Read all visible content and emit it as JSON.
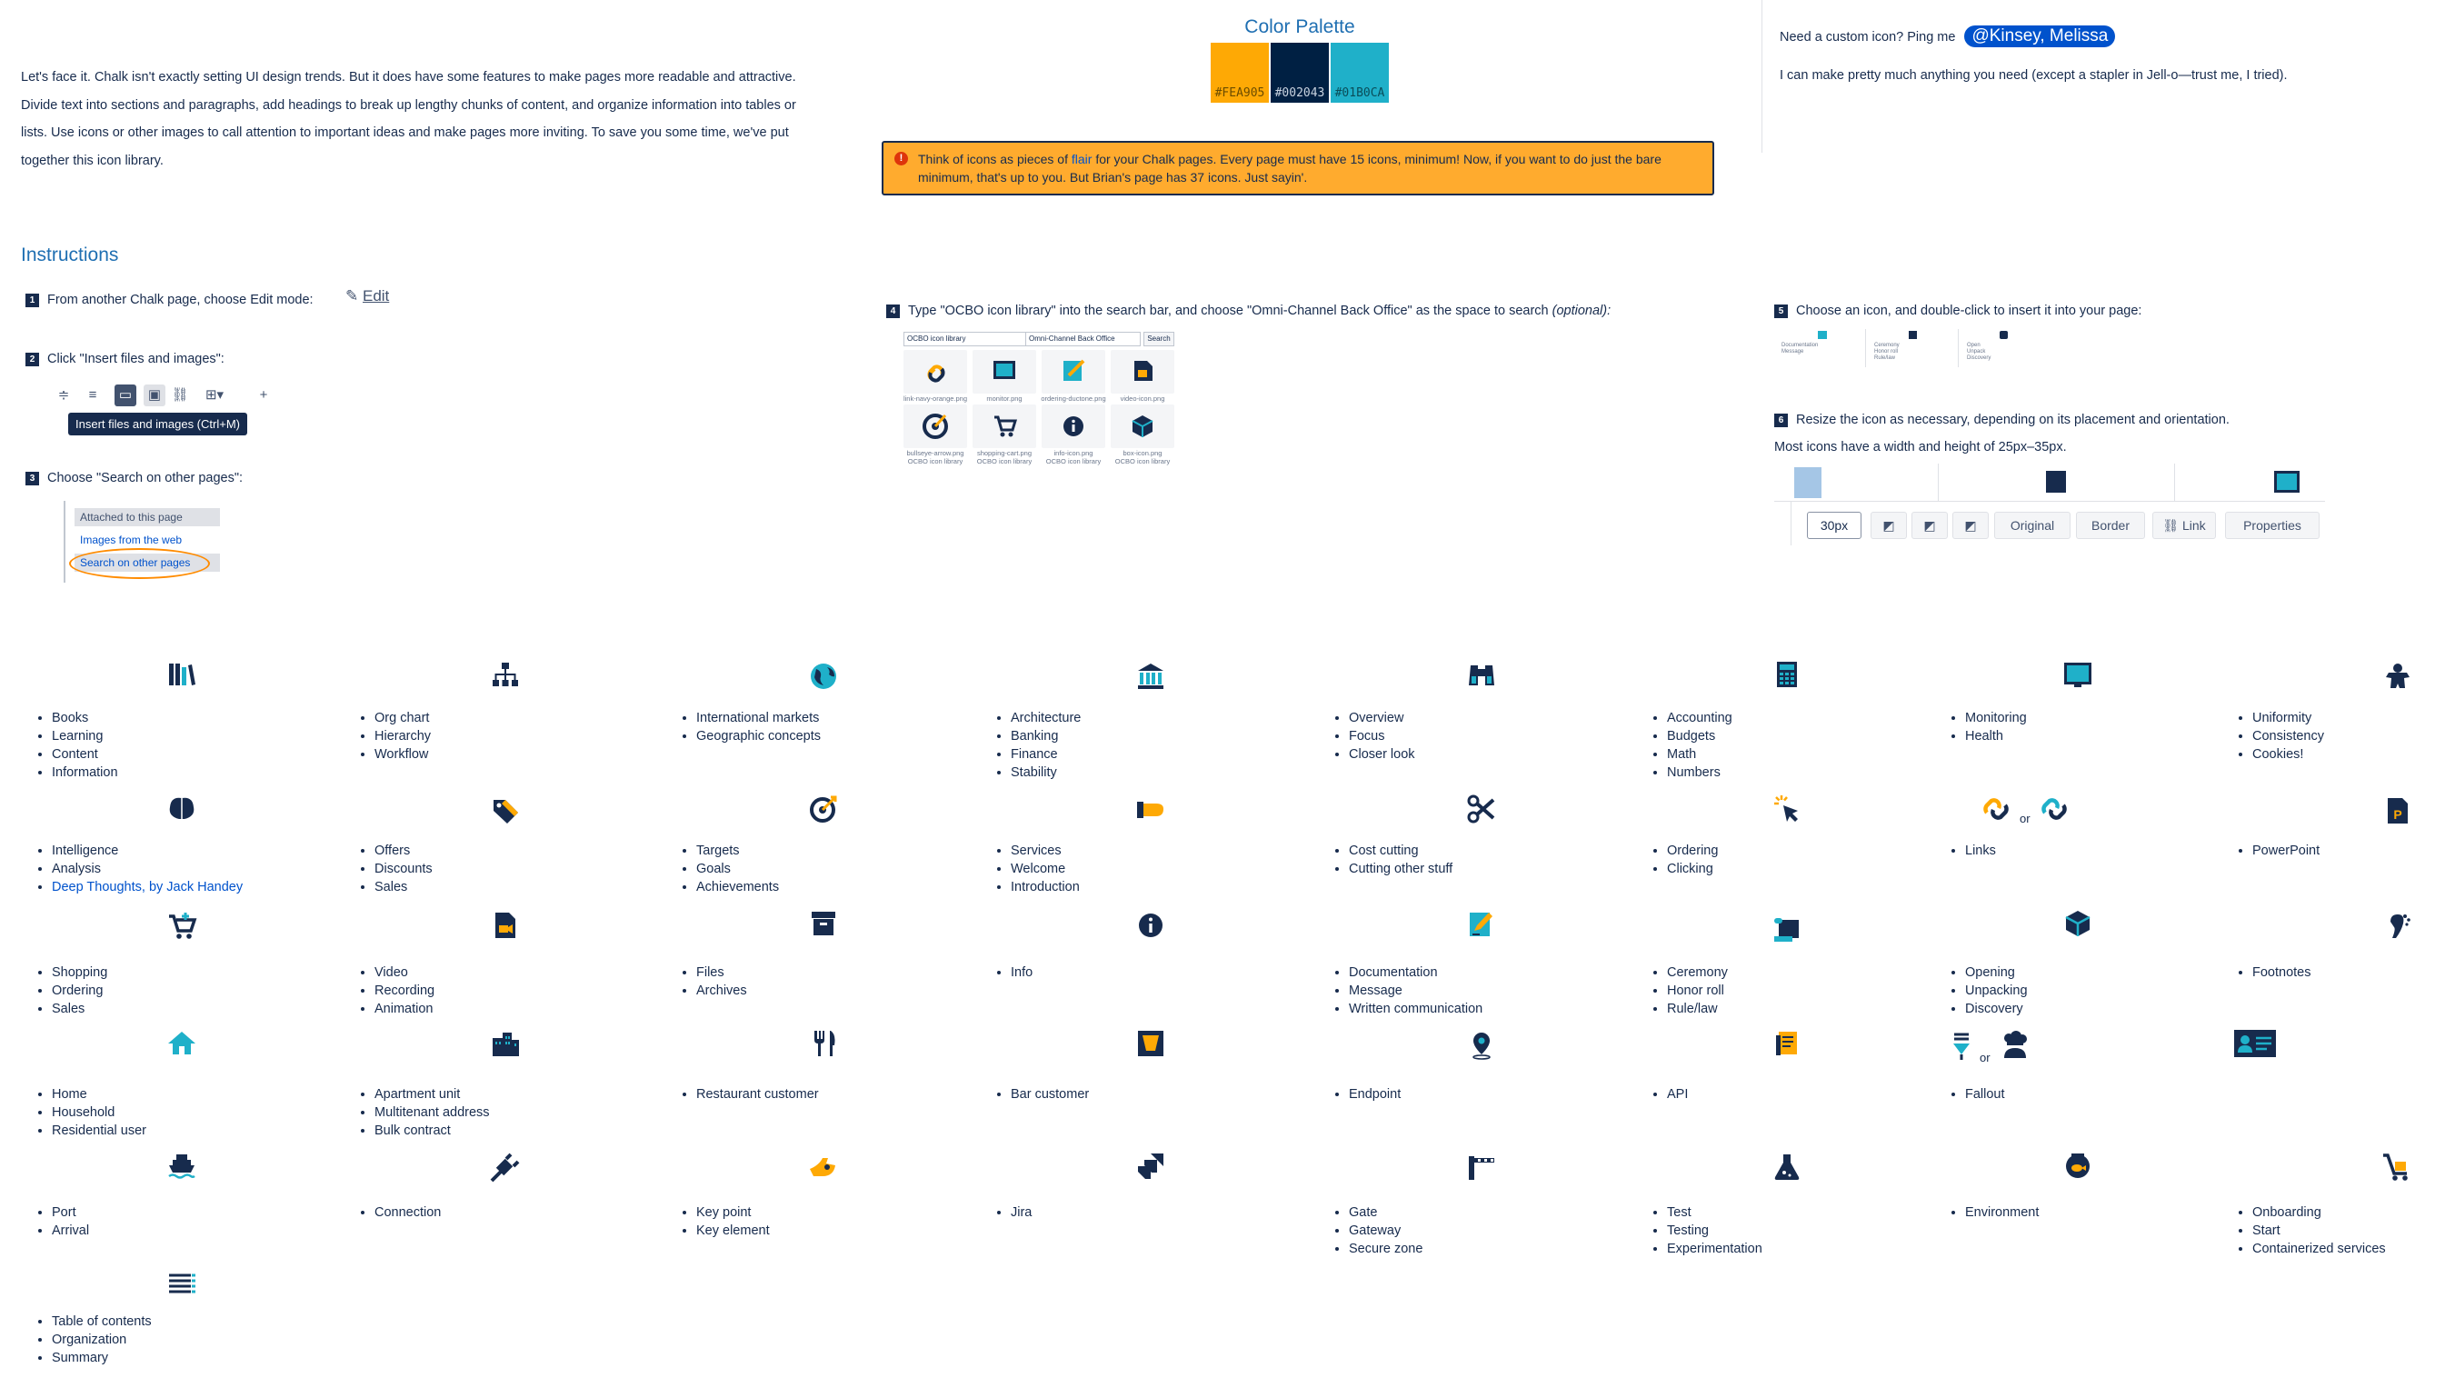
{
  "intro": {
    "text": "Let's face it. Chalk isn't exactly setting UI design trends. But it does have some features to make pages more readable and attractive. Divide text into sections and paragraphs, add headings to break up lengthy chunks of content, and organize information into tables or lists. Use icons or other images to call attention to important ideas and make pages more inviting. To save you some time, we've put together this icon library."
  },
  "palette": {
    "title": "Color Palette",
    "swatches": [
      {
        "label": "#FEA905",
        "color": "#fea905",
        "text_color": "#6b4c00"
      },
      {
        "label": "#002043",
        "color": "#002043",
        "text_color": "#c9d3e0"
      },
      {
        "label": "#01B0CA",
        "color": "#1fb0c9",
        "text_color": "#0a4d59"
      }
    ]
  },
  "flair": {
    "before": "Think of icons as pieces of ",
    "link": "flair",
    "after": " for your Chalk pages. Every page must have 15 icons, minimum! Now, if you want to do just the bare minimum, that's up to you. But Brian's page has 37 icons. Just sayin'."
  },
  "contact": {
    "prompt": "Need a custom icon? Ping me",
    "mention": "@Kinsey, Melissa",
    "note": "I can make pretty much anything you need (except a stapler in Jell-o—trust me, I tried)."
  },
  "instructions": {
    "heading": "Instructions",
    "steps": [
      {
        "num": "1",
        "text": "From another Chalk page, choose Edit mode:"
      },
      {
        "num": "2",
        "text": "Click \"Insert files and images\":"
      },
      {
        "num": "3",
        "text": "Choose \"Search on other pages\":"
      },
      {
        "num": "4",
        "text": "Type \"OCBO icon library\" into the search bar, and choose \"Omni-Channel Back Office\" as the space to search",
        "optional": "(optional):"
      },
      {
        "num": "5",
        "text": "Choose an icon, and double-click to insert it into your page:"
      },
      {
        "num": "6",
        "text": "Resize the icon as necessary, depending on its placement and orientation."
      }
    ],
    "edit_label": "Edit",
    "tooltip": "Insert files and images (Ctrl+M)",
    "menu": [
      "Attached to this page",
      "Images from the web",
      "Search on other pages"
    ],
    "search_query": "OCBO icon library",
    "search_space": "Omni-Channel Back Office",
    "search_button": "Search",
    "results": [
      "link-navy-orange.png",
      "monitor.png",
      "ordering-ductone.png",
      "video-icon.png",
      "bullseye-arrow.png",
      "shopping-cart.png",
      "info-icon.png",
      "box-icon.png"
    ],
    "result_sub": "OCBO icon library",
    "size_note": "Most icons have a width and height of 25px–35px.",
    "size_value": "30px",
    "resize_buttons": [
      "Original",
      "Border",
      "Link",
      "Properties"
    ],
    "step5_items": [
      [
        "Documentation",
        "Message"
      ],
      [
        "Ceremony",
        "Honor roll",
        "Rule/law"
      ],
      [
        "Open",
        "Unpack",
        "Discovery"
      ]
    ]
  },
  "icon_groups": [
    {
      "icon": "books-icon",
      "items": [
        "Books",
        "Learning",
        "Content",
        "Information"
      ]
    },
    {
      "icon": "org-chart-icon",
      "items": [
        "Org chart",
        "Hierarchy",
        "Workflow"
      ]
    },
    {
      "icon": "globe-icon",
      "items": [
        "International markets",
        "Geographic concepts"
      ]
    },
    {
      "icon": "bank-icon",
      "items": [
        "Architecture",
        "Banking",
        "Finance",
        "Stability"
      ]
    },
    {
      "icon": "binoculars-icon",
      "items": [
        "Overview",
        "Focus",
        "Closer look"
      ]
    },
    {
      "icon": "calculator-icon",
      "items": [
        "Accounting",
        "Budgets",
        "Math",
        "Numbers"
      ]
    },
    {
      "icon": "monitor-icon",
      "items": [
        "Monitoring",
        "Health"
      ]
    },
    {
      "icon": "gingerbread-icon",
      "items": [
        "Uniformity",
        "Consistency",
        "Cookies!"
      ]
    },
    {
      "icon": "brain-icon",
      "items": [
        "Intelligence",
        "Analysis"
      ],
      "link": "Deep Thoughts, by Jack Handey"
    },
    {
      "icon": "price-tag-icon",
      "items": [
        "Offers",
        "Discounts",
        "Sales"
      ]
    },
    {
      "icon": "bullseye-icon",
      "items": [
        "Targets",
        "Goals",
        "Achievements"
      ]
    },
    {
      "icon": "welcome-hand-icon",
      "items": [
        "Services",
        "Welcome",
        "Introduction"
      ]
    },
    {
      "icon": "scissors-icon",
      "items": [
        "Cost cutting",
        "Cutting other stuff"
      ]
    },
    {
      "icon": "click-icon",
      "items": [
        "Ordering",
        "Clicking"
      ]
    },
    {
      "icon": "link-icon",
      "items": [
        "Links"
      ],
      "or": "or"
    },
    {
      "icon": "powerpoint-icon",
      "items": [
        "PowerPoint"
      ]
    },
    {
      "icon": "shopping-cart-icon",
      "items": [
        "Shopping",
        "Ordering",
        "Sales"
      ]
    },
    {
      "icon": "video-file-icon",
      "items": [
        "Video",
        "Recording",
        "Animation"
      ]
    },
    {
      "icon": "archive-box-icon",
      "items": [
        "Files",
        "Archives"
      ]
    },
    {
      "icon": "info-icon",
      "items": [
        "Info"
      ]
    },
    {
      "icon": "document-pen-icon",
      "items": [
        "Documentation",
        "Message",
        "Written communication"
      ]
    },
    {
      "icon": "scroll-icon",
      "items": [
        "Ceremony",
        "Honor roll",
        "Rule/law"
      ]
    },
    {
      "icon": "open-box-icon",
      "items": [
        "Opening",
        "Unpacking",
        "Discovery"
      ]
    },
    {
      "icon": "footnote-icon",
      "items": [
        "Footnotes"
      ]
    },
    {
      "icon": "home-icon",
      "items": [
        "Home",
        "Household",
        "Residential user"
      ]
    },
    {
      "icon": "apartment-icon",
      "items": [
        "Apartment unit",
        "Multitenant address",
        "Bulk contract"
      ]
    },
    {
      "icon": "fork-knife-icon",
      "items": [
        "Restaurant customer"
      ]
    },
    {
      "icon": "bar-glass-icon",
      "items": [
        "Bar customer"
      ]
    },
    {
      "icon": "map-pin-icon",
      "items": [
        "Endpoint"
      ]
    },
    {
      "icon": "api-document-icon",
      "items": [
        "API"
      ]
    },
    {
      "icon": "fallout-icon",
      "items": [
        "Fallout"
      ],
      "or": "or"
    },
    {
      "icon": "id-card-icon",
      "items": []
    },
    {
      "icon": "ship-icon",
      "items": [
        "Port",
        "Arrival"
      ]
    },
    {
      "icon": "plug-icon",
      "items": [
        "Connection"
      ]
    },
    {
      "icon": "key-point-icon",
      "items": [
        "Key point",
        "Key element"
      ]
    },
    {
      "icon": "jira-icon",
      "items": [
        "Jira"
      ]
    },
    {
      "icon": "gate-icon",
      "items": [
        "Gate",
        "Gateway",
        "Secure zone"
      ]
    },
    {
      "icon": "flask-icon",
      "items": [
        "Test",
        "Testing",
        "Experimentation"
      ]
    },
    {
      "icon": "fishbowl-icon",
      "items": [
        "Environment"
      ]
    },
    {
      "icon": "onboarding-cart-icon",
      "items": [
        "Onboarding",
        "Start",
        "Containerized services"
      ]
    },
    {
      "icon": "list-icon",
      "items": [
        "Table of contents",
        "Organization",
        "Summary"
      ]
    }
  ],
  "colors": {
    "navy": "#172b4d",
    "orange": "#ffab2e",
    "teal": "#1fb0c9",
    "link": "#0052cc",
    "heading": "#1f6fb2"
  }
}
